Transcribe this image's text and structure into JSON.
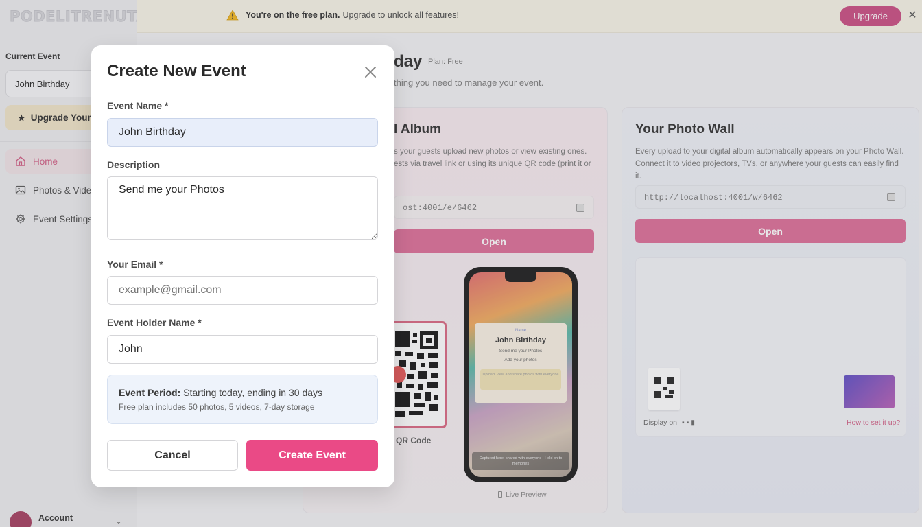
{
  "app": {
    "logo_text": "PODELITRENUTAK"
  },
  "banner": {
    "bold": "You're on the free plan.",
    "text": "Upgrade to unlock all features!",
    "upgrade_label": "Upgrade",
    "close_glyph": "✕"
  },
  "sidebar": {
    "current_event_label": "Current Event",
    "current_event_value": "John Birthday",
    "upgrade_label": "Upgrade Your",
    "nav": [
      {
        "label": "Home",
        "icon": "home-icon",
        "active": true
      },
      {
        "label": "Photos & Video",
        "icon": "image-icon",
        "active": false
      },
      {
        "label": "Event Settings",
        "icon": "gear-icon",
        "active": false
      }
    ],
    "account_label": "Account"
  },
  "main": {
    "title": "day",
    "plan_tag": "Plan: Free",
    "subtitle": "thing you need to manage your event.",
    "album": {
      "heading": "l Album",
      "text_line1": "s your guests upload new photos or view existing ones.",
      "text_line2": "ests via travel link or using its unique QR code (print it or",
      "url": "ost:4001/e/6462",
      "open_label": "Open",
      "qr_label": "QR Code",
      "live_preview": "Live Preview"
    },
    "phone_preview": {
      "small_label": "Name",
      "title": "John Birthday",
      "desc": "Send me your Photos",
      "add": "Add your photos",
      "box_text": "Upload, view and share photos with everyone",
      "footer_text": "Captured here, shared with everyone · Hold on to memories"
    },
    "wall": {
      "heading": "Your Photo Wall",
      "text_line1": "Every upload to your digital album automatically appears on your Photo Wall.",
      "text_line2": "Connect it to video projectors, TVs, or anywhere your guests can easily find it.",
      "url": "http://localhost:4001/w/6462",
      "open_label": "Open",
      "display_on": "Display on",
      "how_link": "How to set it up?"
    }
  },
  "modal": {
    "title": "Create New Event",
    "event_name_label": "Event Name *",
    "event_name_value": "John Birthday",
    "description_label": "Description",
    "description_value": "Send me your Photos",
    "email_label": "Your Email *",
    "email_placeholder": "example@gmail.com",
    "holder_label": "Event Holder Name *",
    "holder_value": "John",
    "period_bold": "Event Period:",
    "period_text": "Starting today, ending in 30 days",
    "period_note": "Free plan includes 50 photos, 5 videos, 7-day storage",
    "cancel_label": "Cancel",
    "create_label": "Create Event"
  },
  "colors": {
    "accent": "#ea4a86",
    "banner_bg": "#f7f3e6",
    "period_bg": "#eef3fb"
  }
}
